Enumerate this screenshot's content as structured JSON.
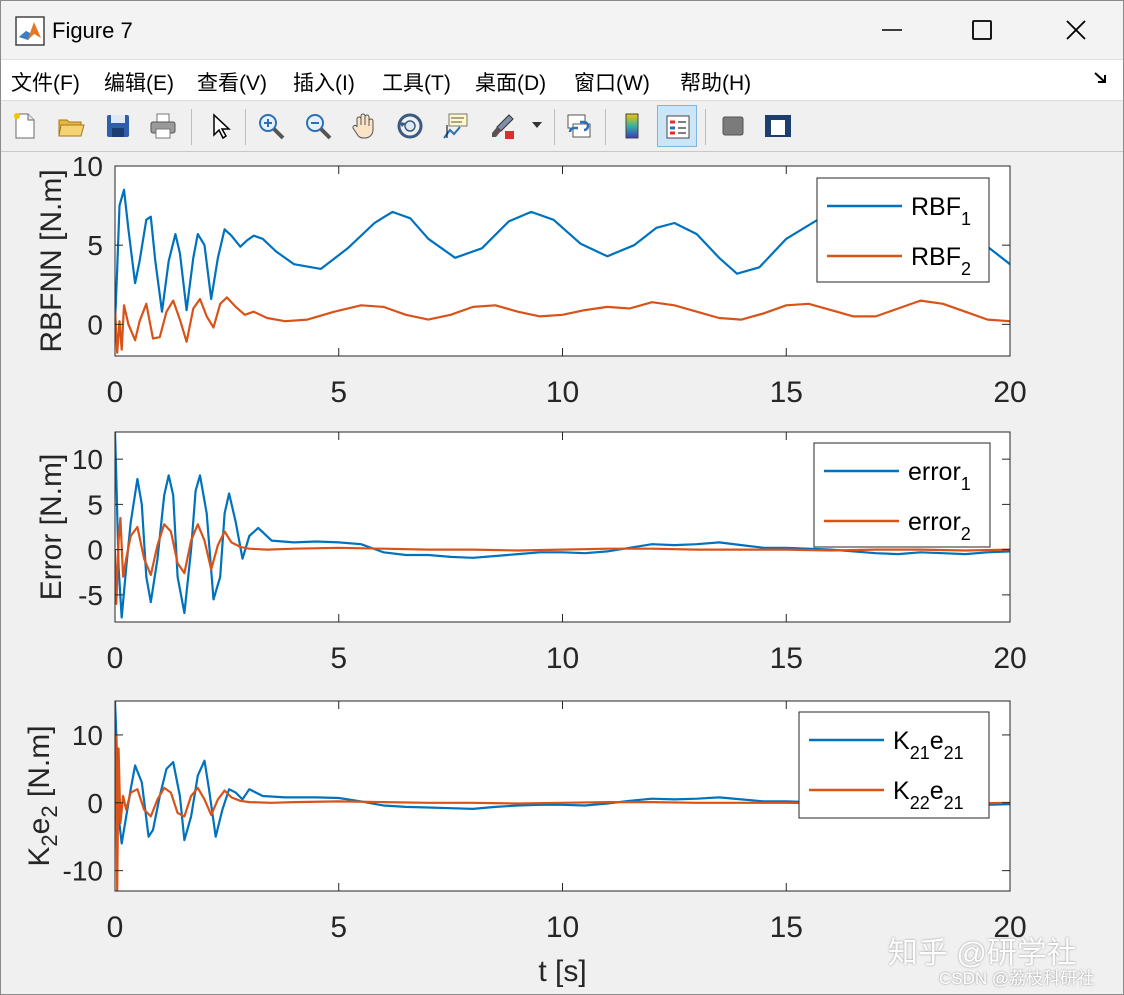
{
  "window": {
    "title": "Figure 7"
  },
  "menu": {
    "items": [
      "文件(F)",
      "编辑(E)",
      "查看(V)",
      "插入(I)",
      "工具(T)",
      "桌面(D)",
      "窗口(W)",
      "帮助(H)"
    ]
  },
  "toolbar": {
    "buttons": [
      "new-figure-icon",
      "open-file-icon",
      "save-icon",
      "print-icon",
      "pointer-icon",
      "zoom-in-icon",
      "zoom-out-icon",
      "pan-icon",
      "rotate-3d-icon",
      "data-cursor-icon",
      "brush-icon",
      "link-plot-icon",
      "colorbar-icon",
      "legend-icon",
      "hide-plot-tools-icon",
      "show-plot-tools-icon"
    ],
    "pressed": "legend-icon"
  },
  "colors": {
    "series1": "#0072BD",
    "series2": "#D95319"
  },
  "watermark": {
    "main": "知乎 @研学社",
    "sub": "CSDN @荔枝科研社"
  },
  "chart_data": [
    {
      "type": "line",
      "ylabel": "RBFNN [N.m]",
      "xlabel": "",
      "xlim": [
        0,
        20
      ],
      "ylim": [
        -2,
        10
      ],
      "xticks": [
        0,
        5,
        10,
        15,
        20
      ],
      "yticks": [
        0,
        5,
        10
      ],
      "legend_position": "top-right",
      "series": [
        {
          "name": "RBF1",
          "legend": {
            "base": "RBF",
            "sub": "1"
          },
          "x": [
            0,
            0.05,
            0.1,
            0.2,
            0.3,
            0.45,
            0.55,
            0.7,
            0.8,
            0.9,
            1.05,
            1.2,
            1.35,
            1.45,
            1.6,
            1.75,
            1.85,
            2.0,
            2.15,
            2.3,
            2.45,
            2.6,
            2.8,
            2.95,
            3.1,
            3.3,
            3.6,
            4.0,
            4.6,
            5.2,
            5.8,
            6.2,
            6.6,
            7.0,
            7.6,
            8.2,
            8.8,
            9.3,
            9.8,
            10.4,
            11.0,
            11.6,
            12.1,
            12.5,
            13.0,
            13.5,
            13.9,
            14.4,
            15.0,
            15.7,
            16.2,
            16.6,
            17.1,
            17.6,
            18.0,
            18.5,
            19.0,
            19.5,
            20.0
          ],
          "y": [
            0.0,
            3.5,
            7.5,
            8.5,
            6.0,
            2.6,
            4.0,
            6.6,
            6.8,
            4.0,
            0.8,
            4.0,
            5.7,
            4.5,
            0.9,
            4.2,
            5.7,
            5.0,
            1.6,
            4.2,
            6.0,
            5.6,
            4.9,
            5.3,
            5.6,
            5.4,
            4.6,
            3.8,
            3.5,
            4.8,
            6.4,
            7.1,
            6.7,
            5.4,
            4.2,
            4.8,
            6.5,
            7.1,
            6.6,
            5.1,
            4.3,
            5.0,
            6.1,
            6.4,
            5.7,
            4.2,
            3.2,
            3.6,
            5.4,
            6.6,
            6.3,
            5.6,
            5.0,
            5.6,
            6.0,
            5.4,
            5.2,
            4.9,
            3.8
          ]
        },
        {
          "name": "RBF2",
          "legend": {
            "base": "RBF",
            "sub": "2"
          },
          "x": [
            0,
            0.05,
            0.1,
            0.15,
            0.2,
            0.3,
            0.45,
            0.55,
            0.7,
            0.85,
            1.0,
            1.15,
            1.3,
            1.45,
            1.6,
            1.75,
            1.9,
            2.05,
            2.2,
            2.35,
            2.5,
            2.7,
            2.9,
            3.1,
            3.4,
            3.8,
            4.3,
            4.9,
            5.5,
            6.0,
            6.5,
            7.0,
            7.5,
            8.0,
            8.5,
            9.0,
            9.5,
            10.0,
            10.5,
            11.0,
            11.5,
            12.0,
            12.5,
            13.0,
            13.5,
            14.0,
            14.5,
            15.0,
            15.5,
            16.0,
            16.5,
            17.0,
            17.5,
            18.0,
            18.5,
            19.0,
            19.5,
            20.0
          ],
          "y": [
            1.0,
            -1.8,
            0.2,
            -1.6,
            1.2,
            0.0,
            -1.0,
            0.2,
            1.3,
            -0.9,
            -0.8,
            0.8,
            1.5,
            0.3,
            -1.1,
            1.0,
            1.6,
            0.5,
            -0.2,
            1.3,
            1.7,
            1.1,
            0.6,
            0.8,
            0.4,
            0.2,
            0.3,
            0.8,
            1.2,
            1.1,
            0.6,
            0.3,
            0.6,
            1.1,
            1.2,
            0.8,
            0.5,
            0.6,
            0.9,
            1.1,
            1.0,
            1.4,
            1.2,
            0.8,
            0.4,
            0.3,
            0.7,
            1.2,
            1.3,
            0.9,
            0.5,
            0.5,
            1.0,
            1.5,
            1.3,
            0.8,
            0.3,
            0.2
          ]
        }
      ]
    },
    {
      "type": "line",
      "ylabel": "Error [N.m]",
      "xlabel": "",
      "xlim": [
        0,
        20
      ],
      "ylim": [
        -8,
        13
      ],
      "xticks": [
        0,
        5,
        10,
        15,
        20
      ],
      "yticks": [
        -5,
        0,
        5,
        10
      ],
      "legend_position": "top-right",
      "series": [
        {
          "name": "error1",
          "legend": {
            "base": "error",
            "sub": "1"
          },
          "x": [
            0,
            0.03,
            0.08,
            0.15,
            0.25,
            0.35,
            0.5,
            0.6,
            0.7,
            0.8,
            0.95,
            1.1,
            1.2,
            1.3,
            1.4,
            1.55,
            1.7,
            1.8,
            1.9,
            2.05,
            2.2,
            2.35,
            2.45,
            2.55,
            2.7,
            2.85,
            3.0,
            3.2,
            3.5,
            4.0,
            4.5,
            5.0,
            5.5,
            6.0,
            6.5,
            7.0,
            7.5,
            8.0,
            8.5,
            9.0,
            9.5,
            10.0,
            10.5,
            11.0,
            11.5,
            12.0,
            12.5,
            13.0,
            13.5,
            14.0,
            14.5,
            15.0,
            15.5,
            16.0,
            16.5,
            17.0,
            17.5,
            18.0,
            18.5,
            19.0,
            19.5,
            20.0
          ],
          "y": [
            13,
            8,
            -2,
            -7.5,
            -2,
            3,
            7.8,
            5,
            -3,
            -5.8,
            -1,
            6,
            8.2,
            6,
            -3,
            -7,
            0,
            6.5,
            8.2,
            4,
            -5.5,
            -3,
            4,
            6.2,
            3,
            -1,
            1.5,
            2.4,
            1.0,
            0.8,
            0.9,
            0.8,
            0.6,
            -0.3,
            -0.6,
            -0.6,
            -0.8,
            -0.9,
            -0.7,
            -0.5,
            -0.3,
            -0.3,
            -0.4,
            -0.2,
            0.2,
            0.6,
            0.5,
            0.6,
            0.8,
            0.5,
            0.2,
            0.2,
            0.1,
            0.0,
            -0.2,
            -0.4,
            -0.5,
            -0.3,
            -0.4,
            -0.5,
            -0.3,
            -0.2
          ]
        },
        {
          "name": "error2",
          "legend": {
            "base": "error",
            "sub": "2"
          },
          "x": [
            0,
            0.03,
            0.08,
            0.12,
            0.18,
            0.25,
            0.35,
            0.5,
            0.65,
            0.8,
            0.95,
            1.1,
            1.25,
            1.4,
            1.55,
            1.7,
            1.85,
            2.0,
            2.15,
            2.3,
            2.45,
            2.6,
            2.8,
            3.0,
            3.4,
            4.0,
            5.0,
            6.0,
            7.0,
            8.0,
            9.0,
            10.0,
            11.0,
            12.0,
            13.0,
            14.0,
            15.0,
            16.0,
            17.0,
            18.0,
            19.0,
            20.0
          ],
          "y": [
            0,
            -6,
            1,
            3.5,
            -3,
            -1,
            1.5,
            2.5,
            -1,
            -2.8,
            0.5,
            2.8,
            2.0,
            -1.5,
            -2.6,
            1,
            2.8,
            1,
            -2.2,
            0.5,
            2.0,
            0.8,
            0.3,
            0.1,
            0.0,
            0.1,
            0.2,
            0.1,
            0.0,
            0.0,
            -0.1,
            0.0,
            0.1,
            0.1,
            0.0,
            0.0,
            0.0,
            -0.1,
            0.0,
            0.0,
            -0.1,
            0.0
          ]
        }
      ]
    },
    {
      "type": "line",
      "ylabel": "K2e2 [N.m]",
      "ylabel_parts": {
        "k": "K",
        "ksub": "2",
        "e": "e",
        "esub": "2",
        "unit": " [N.m]"
      },
      "xlabel": "t [s]",
      "xlim": [
        0,
        20
      ],
      "ylim": [
        -13,
        15
      ],
      "xticks": [
        0,
        5,
        10,
        15,
        20
      ],
      "yticks": [
        -10,
        0,
        10
      ],
      "legend_position": "top-right",
      "series": [
        {
          "name": "K21e21",
          "legend": {
            "base": "K",
            "sub": "21",
            "base2": "e",
            "sub2": "21"
          },
          "x": [
            0,
            0.03,
            0.08,
            0.15,
            0.25,
            0.35,
            0.45,
            0.6,
            0.75,
            0.85,
            1.0,
            1.15,
            1.3,
            1.45,
            1.55,
            1.7,
            1.85,
            2.0,
            2.1,
            2.25,
            2.4,
            2.55,
            2.7,
            2.85,
            3.0,
            3.3,
            3.8,
            4.5,
            5.0,
            5.5,
            6.0,
            6.5,
            7.0,
            7.5,
            8.0,
            8.5,
            9.0,
            9.5,
            10.0,
            10.5,
            11.0,
            11.5,
            12.0,
            12.5,
            13.0,
            13.5,
            14.0,
            14.5,
            15.0,
            15.5,
            16.0,
            16.5,
            17.0,
            17.5,
            18.0,
            18.5,
            19.0,
            19.5,
            20.0
          ],
          "y": [
            15,
            10,
            -2,
            -6,
            -2,
            2,
            5.5,
            3,
            -5,
            -4,
            1,
            5,
            6,
            1,
            -5.5,
            -2,
            4,
            6.2,
            2,
            -5,
            -1,
            2,
            1.5,
            0.5,
            2,
            1.0,
            0.8,
            0.8,
            0.7,
            0.2,
            -0.4,
            -0.6,
            -0.7,
            -0.8,
            -0.9,
            -0.6,
            -0.4,
            -0.3,
            -0.3,
            -0.4,
            -0.1,
            0.3,
            0.6,
            0.5,
            0.6,
            0.8,
            0.5,
            0.2,
            0.2,
            0.1,
            0.0,
            -0.2,
            -0.4,
            -0.5,
            -0.3,
            -0.4,
            -0.4,
            -0.3,
            -0.2
          ]
        },
        {
          "name": "K22e21",
          "legend": {
            "base": "K",
            "sub": "22",
            "base2": "e",
            "sub2": "21"
          },
          "x": [
            0,
            0.02,
            0.05,
            0.08,
            0.12,
            0.18,
            0.25,
            0.35,
            0.5,
            0.65,
            0.8,
            0.95,
            1.1,
            1.25,
            1.4,
            1.55,
            1.7,
            1.85,
            2.0,
            2.15,
            2.3,
            2.45,
            2.6,
            2.8,
            3.0,
            3.5,
            4.0,
            5.0,
            6.0,
            7.0,
            8.0,
            9.0,
            10.0,
            11.0,
            12.0,
            13.0,
            14.0,
            15.0,
            16.0,
            17.0,
            18.0,
            19.0,
            20.0
          ],
          "y": [
            0,
            10,
            -13,
            8,
            -3,
            1,
            -1,
            1.5,
            2.0,
            -1,
            -2,
            0.5,
            2.2,
            1.5,
            -1.5,
            -2,
            1,
            2.2,
            0.5,
            -1.8,
            0.5,
            1.8,
            0.8,
            0.3,
            0.1,
            0.0,
            0.1,
            0.2,
            0.1,
            0.0,
            0.0,
            -0.1,
            0.0,
            0.1,
            0.1,
            0.0,
            0.0,
            0.0,
            -0.1,
            0.0,
            0.0,
            -0.1,
            0.0
          ]
        }
      ]
    }
  ]
}
